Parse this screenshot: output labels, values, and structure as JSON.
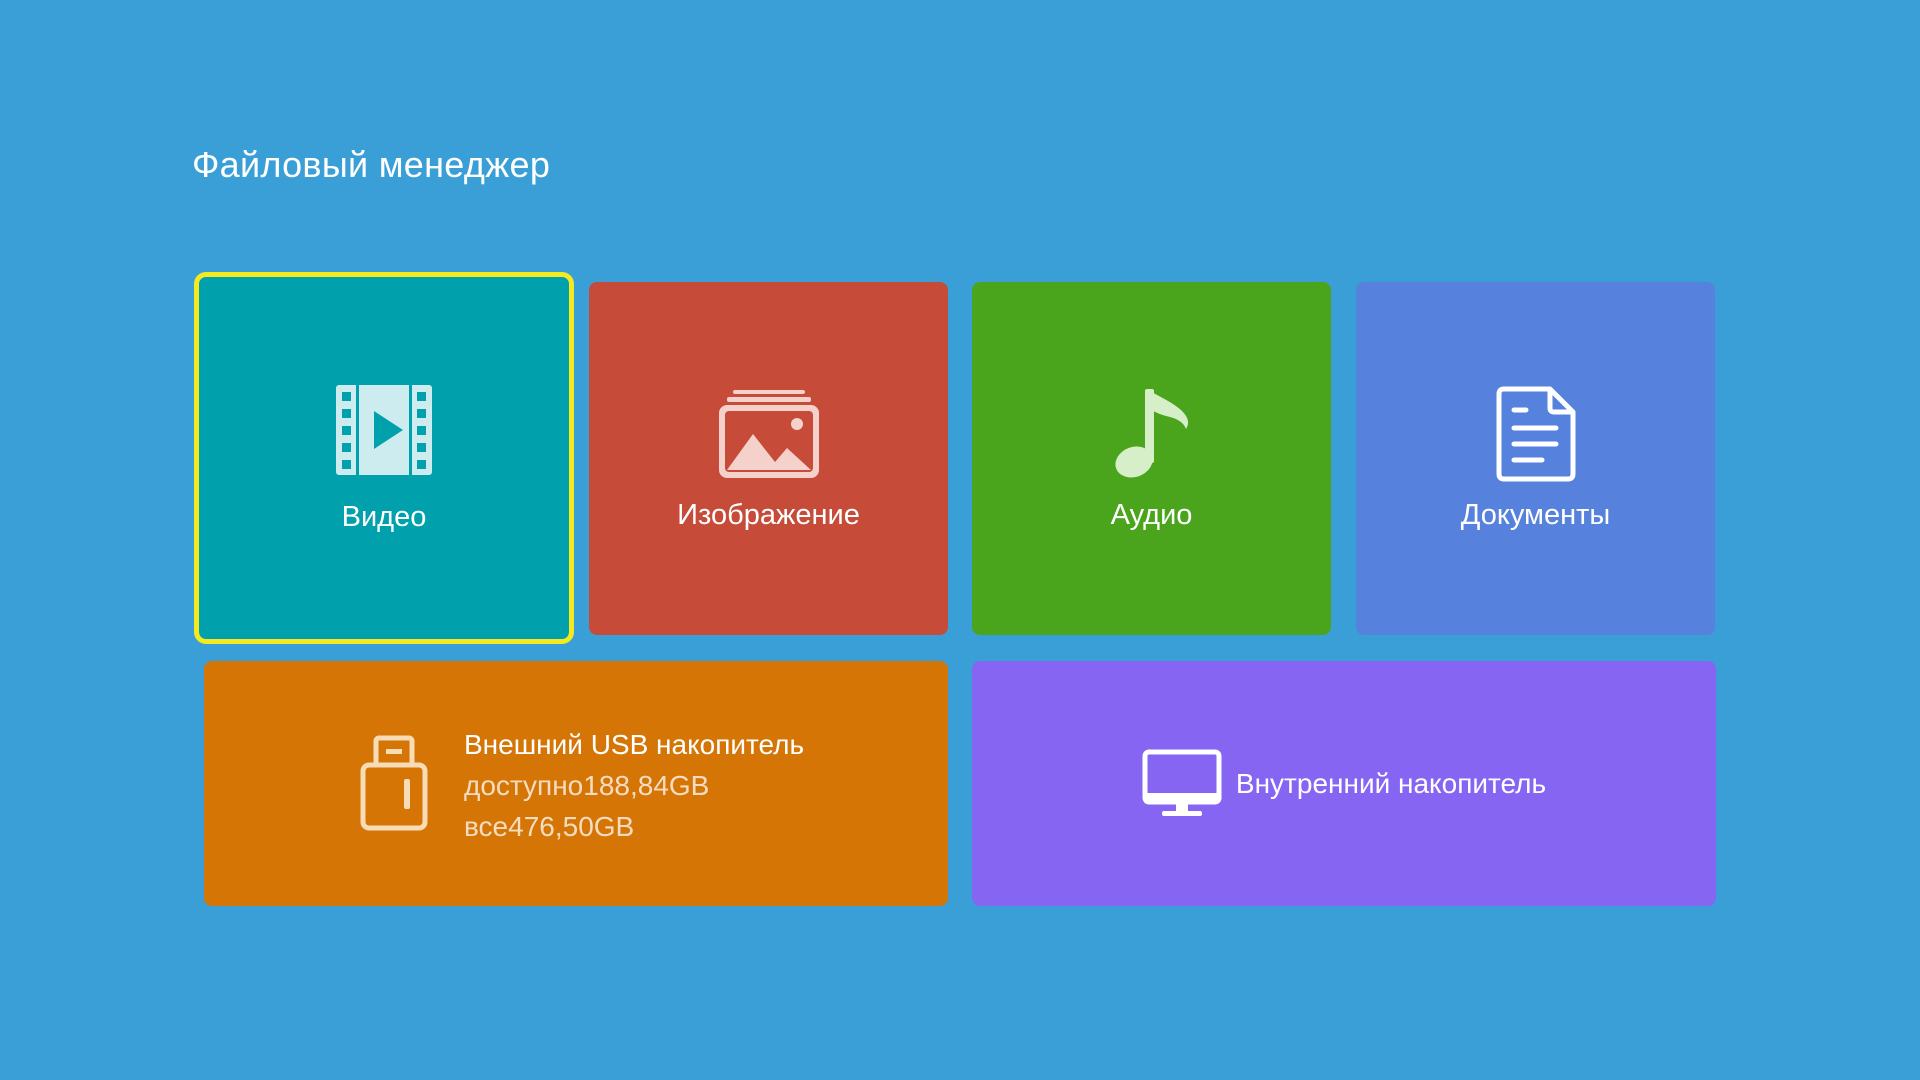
{
  "header": {
    "title": "Файловый менеджер"
  },
  "categories": [
    {
      "id": "video",
      "label": "Видео",
      "color": "#00a0ad",
      "icon": "film-icon",
      "selected": true
    },
    {
      "id": "image",
      "label": "Изображение",
      "color": "#c64b38",
      "icon": "picture-icon",
      "selected": false
    },
    {
      "id": "audio",
      "label": "Аудио",
      "color": "#4aa51c",
      "icon": "music-note-icon",
      "selected": false
    },
    {
      "id": "docs",
      "label": "Документы",
      "color": "#5681dc",
      "icon": "document-icon",
      "selected": false
    }
  ],
  "storage": {
    "usb": {
      "name": "Внешний USB накопитель",
      "available": "доступно188,84GB",
      "total": "все476,50GB",
      "color": "#d57506",
      "icon": "usb-drive-icon"
    },
    "internal": {
      "name": "Внутренний накопитель",
      "color": "#8665f3",
      "icon": "monitor-icon"
    }
  },
  "colors": {
    "background": "#3a9fd6",
    "focus_border": "#f5ea20"
  }
}
